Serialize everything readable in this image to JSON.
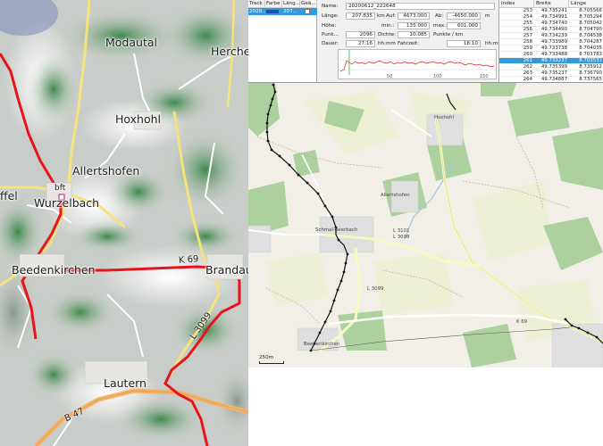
{
  "left_map": {
    "places": [
      "Modautal",
      "Herche",
      "Hoxhohl",
      "Allertshofen",
      "Wurzelbach",
      "ffel",
      "Beedenkirchen",
      "Brandau",
      "Lautern",
      "bft"
    ],
    "roads": [
      "K 69",
      "L 3099",
      "B 47"
    ],
    "route_color": "#e8141b"
  },
  "track_table": {
    "headers": [
      "Track",
      "Farbe",
      "Läng...",
      "Geä..."
    ],
    "row": {
      "name": "2020...",
      "length": "207..."
    }
  },
  "properties": {
    "name_label": "Name:",
    "name_value": "20200612_222648",
    "length_label": "Länge:",
    "length_value": "207.835",
    "length_unit": "km",
    "up_label": "Auf:",
    "up_value": "4673.000",
    "down_label": "Ab:",
    "down_value": "-4650.000",
    "down_unit": "m",
    "height_label": "Höhe:",
    "min_label": "min.:",
    "min_value": "135.000",
    "max_label": "max.:",
    "max_value": "601.000",
    "points_label": "Punk...",
    "points_value": "2096",
    "density_label": "Dichte:",
    "density_value": "10.085",
    "density_unit": "Punkte / km",
    "duration_label": "Dauer:",
    "duration_value": "27:16",
    "duration_unit": "hh:mm",
    "drive_label": "Fahrzeit:",
    "drive_value": "18:10",
    "drive_unit": "hh:mm",
    "profile_ticks": [
      "50",
      "100",
      "150"
    ]
  },
  "points_table": {
    "headers": [
      "Index",
      "Breite",
      "Länge"
    ],
    "rows": [
      [
        "253",
        "49.735241",
        "8.705566"
      ],
      [
        "254",
        "49.734991",
        "8.705294"
      ],
      [
        "255",
        "49.734740",
        "8.705042"
      ],
      [
        "256",
        "49.734490",
        "8.704790"
      ],
      [
        "257",
        "49.734239",
        "8.704538"
      ],
      [
        "258",
        "49.733989",
        "8.704287"
      ],
      [
        "259",
        "49.733738",
        "8.704035"
      ],
      [
        "260",
        "49.733488",
        "8.703783"
      ],
      [
        "261",
        "49.733237",
        "8.703531"
      ],
      [
        "262",
        "49.735399",
        "8.735912"
      ],
      [
        "263",
        "49.735237",
        "8.736790"
      ],
      [
        "264",
        "49.734887",
        "8.737565"
      ]
    ],
    "selected_index": 8,
    "selection_color": "#3399dd"
  },
  "osm_map": {
    "places": [
      "Hoxhohl",
      "Allertshofen",
      "Schmal-Beerbach",
      "Beedenkirchen"
    ],
    "roads": [
      "L 3101",
      "L 3098",
      "L 3099",
      "K 69"
    ],
    "scale_label": "250m",
    "track_color": "#111111"
  }
}
